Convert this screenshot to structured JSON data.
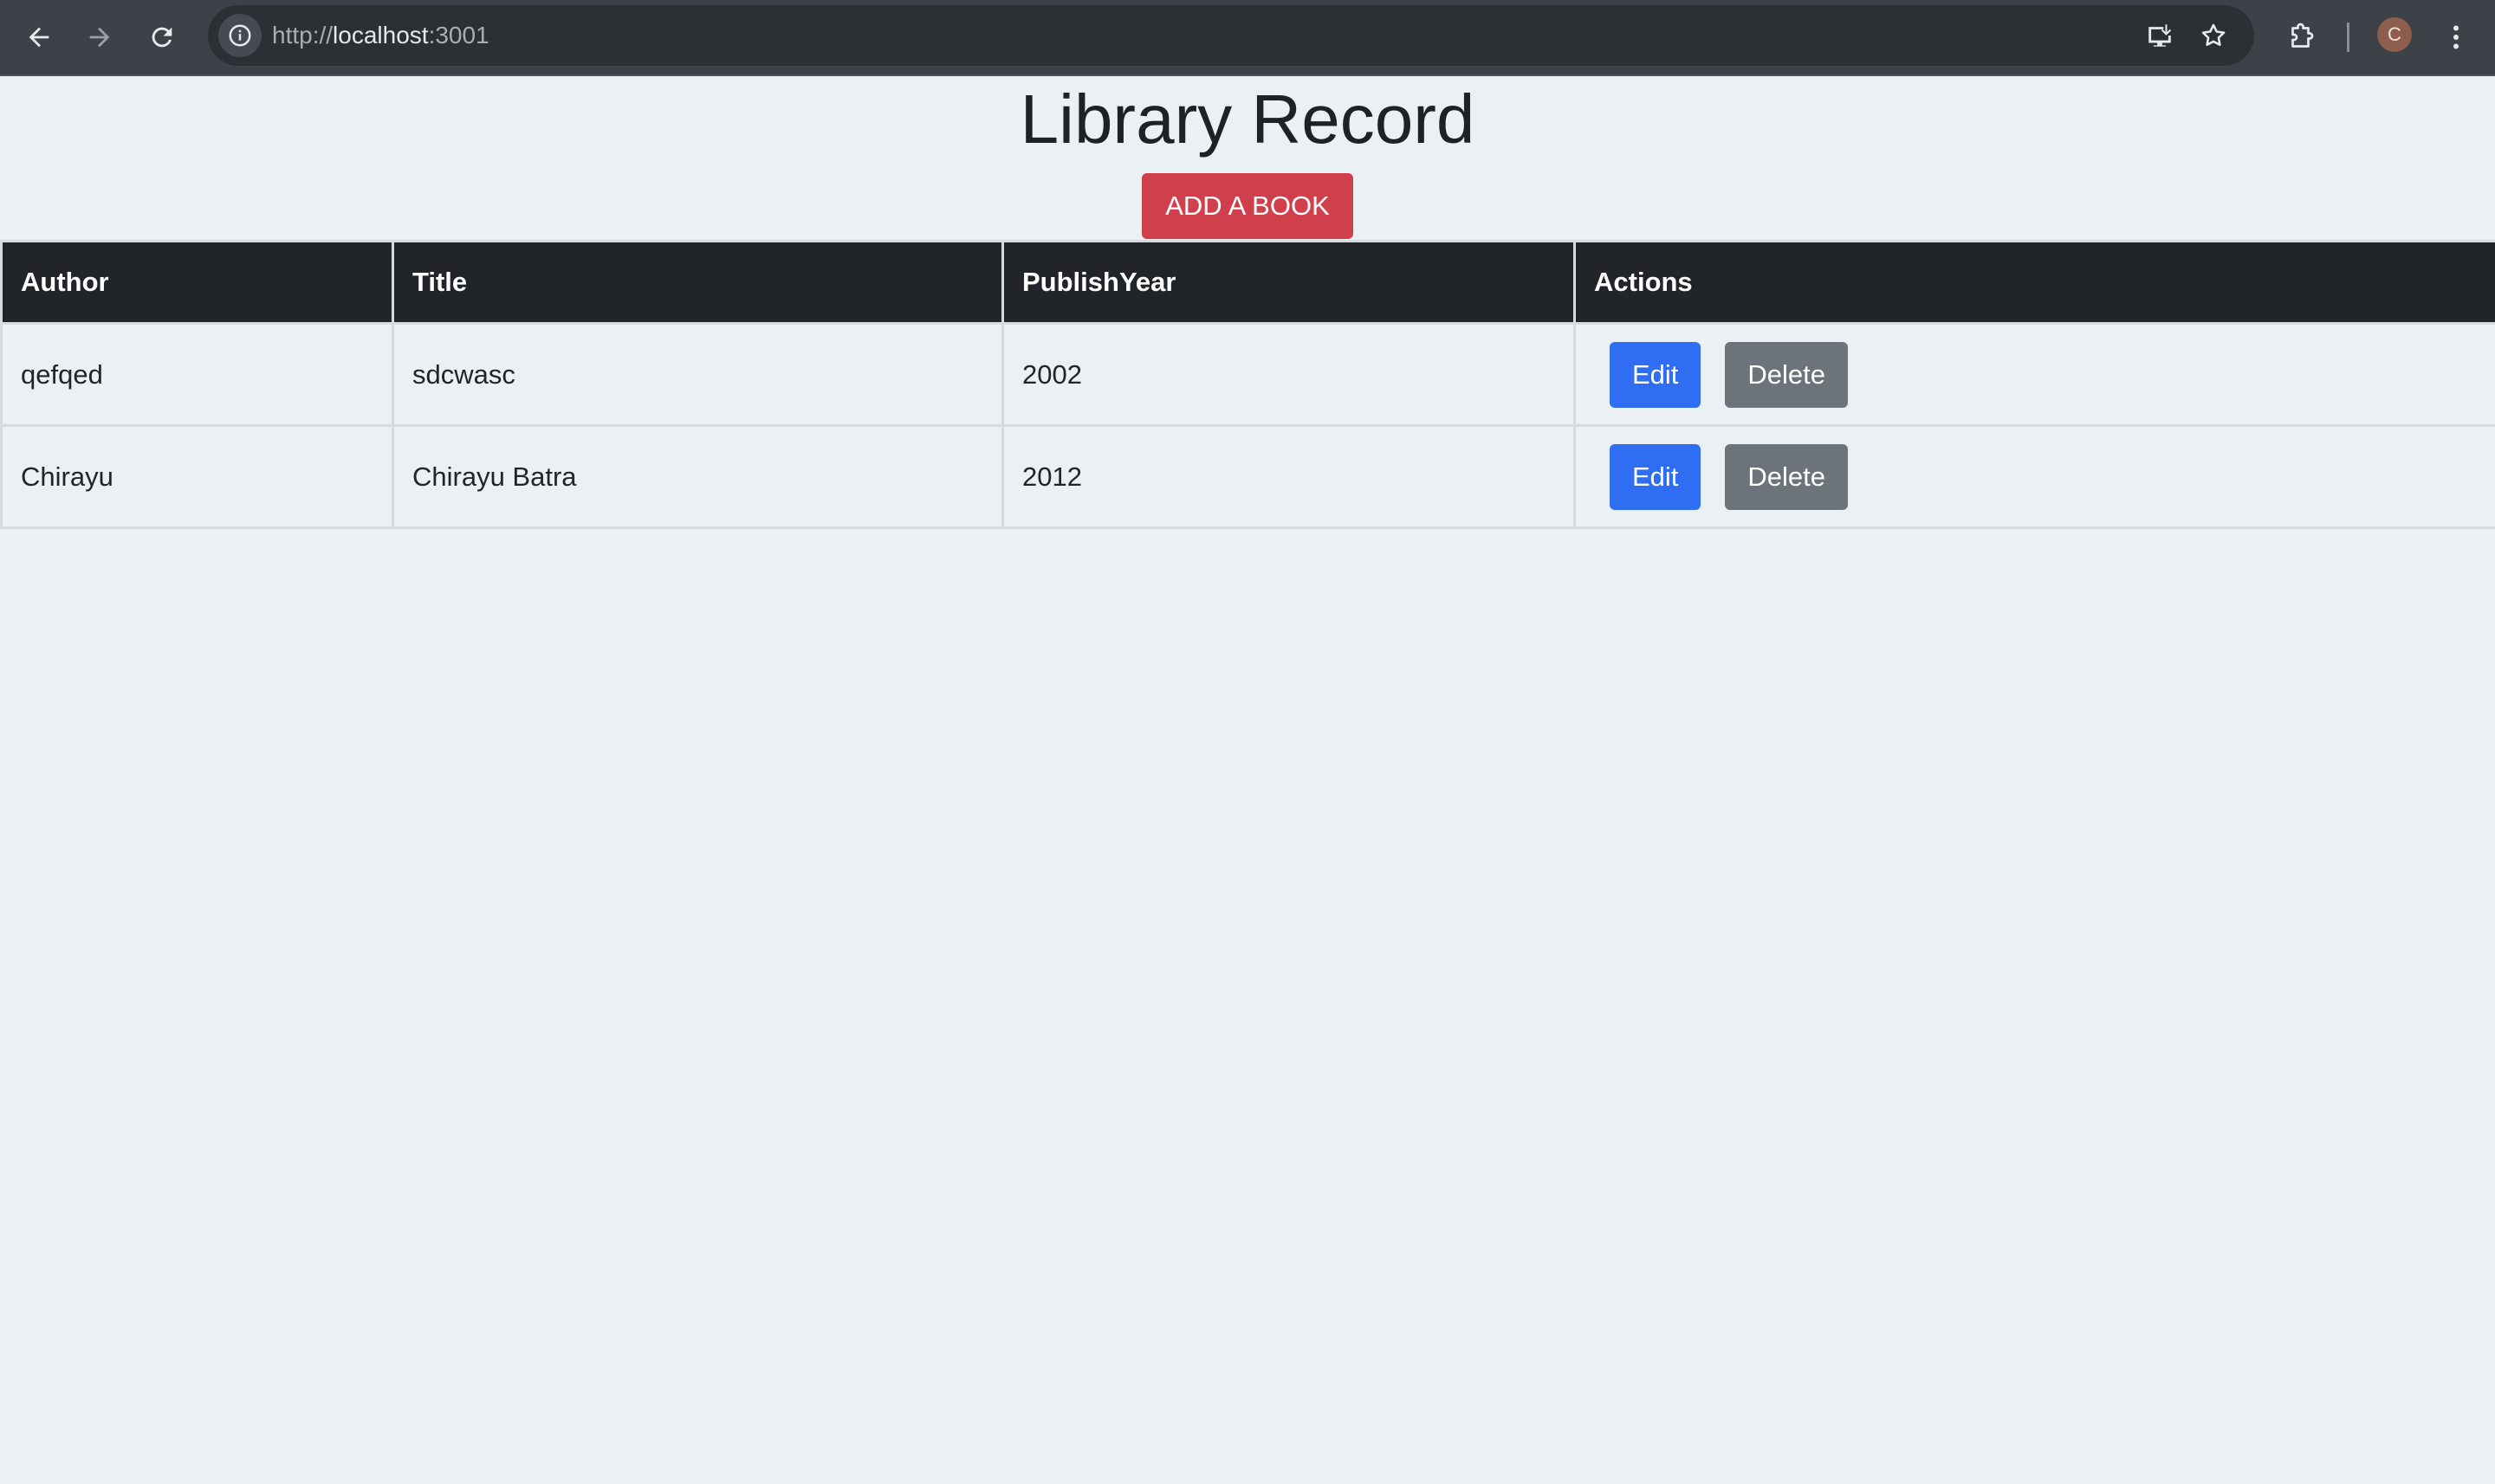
{
  "browser": {
    "url_scheme": "http://",
    "url_host": "localhost",
    "url_port": ":3001",
    "profile_initial": "C",
    "icons": [
      "back-icon",
      "forward-icon",
      "reload-icon",
      "site-info-icon",
      "install-app-icon",
      "bookmark-star-icon",
      "extensions-icon",
      "profile-avatar",
      "menu-kebab-icon"
    ]
  },
  "page": {
    "title": "Library Record",
    "add_button_label": "ADD A BOOK"
  },
  "table": {
    "headers": {
      "author": "Author",
      "title": "Title",
      "year": "PublishYear",
      "actions": "Actions"
    },
    "rows": [
      {
        "author": "qefqed",
        "title": "sdcwasc",
        "year": "2002",
        "edit": "Edit",
        "delete": "Delete"
      },
      {
        "author": "Chirayu",
        "title": "Chirayu Batra",
        "year": "2012",
        "edit": "Edit",
        "delete": "Delete"
      }
    ]
  },
  "colors": {
    "page_bg": "#ebf0f5",
    "header_bg": "#212529",
    "add_button": "#d0404c",
    "edit_button": "#2f6ef2",
    "delete_button": "#6c737a"
  }
}
